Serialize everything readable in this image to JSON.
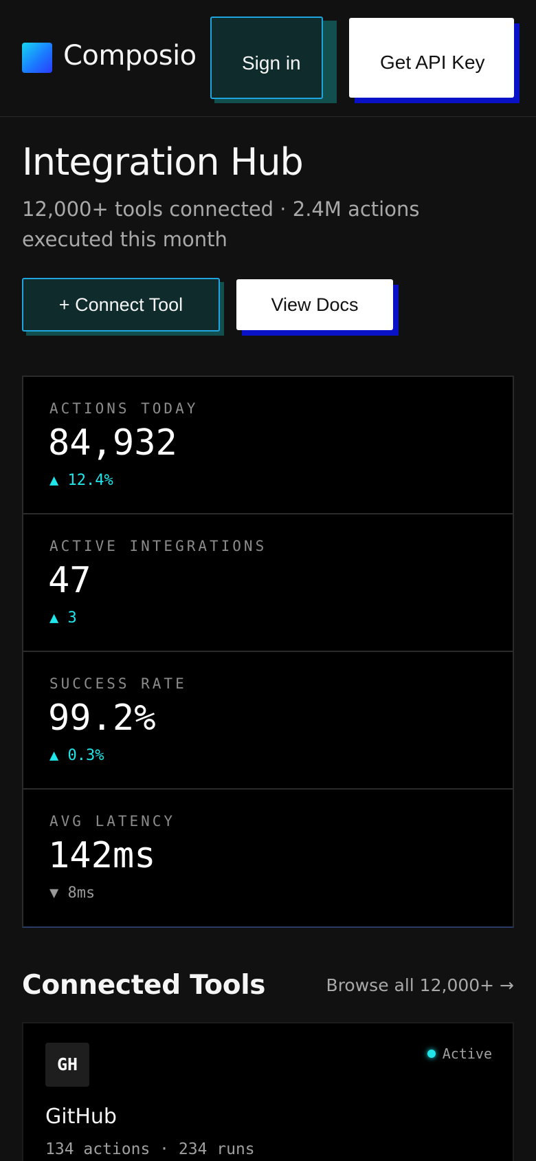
{
  "header": {
    "brand": "Composio",
    "signin_label": "Sign in",
    "api_key_label": "Get API Key"
  },
  "hero": {
    "title": "Integration Hub",
    "subtitle": "12,000+ tools connected · 2.4M actions executed this month",
    "connect_label": "+ Connect Tool",
    "docs_label": "View Docs"
  },
  "stats": [
    {
      "label": "ACTIONS TODAY",
      "value": "84,932",
      "delta": "▲ 12.4%",
      "direction": "up"
    },
    {
      "label": "ACTIVE INTEGRATIONS",
      "value": "47",
      "delta": "▲ 3",
      "direction": "up"
    },
    {
      "label": "SUCCESS RATE",
      "value": "99.2%",
      "delta": "▲ 0.3%",
      "direction": "up"
    },
    {
      "label": "AVG LATENCY",
      "value": "142ms",
      "delta": "▼ 8ms",
      "direction": "down"
    }
  ],
  "tools_section": {
    "title": "Connected Tools",
    "browse_label": "Browse all 12,000+ →",
    "tools": [
      {
        "abbr": "GH",
        "name": "GitHub",
        "status": "Active",
        "meta": "134 actions · 234 runs"
      }
    ]
  },
  "colors": {
    "background": "#111111",
    "accent_cyan": "#1fe6ea",
    "accent_blue_border": "#1fa6e0",
    "shadow_blue": "#0a12c8",
    "shadow_teal": "#12504f"
  }
}
